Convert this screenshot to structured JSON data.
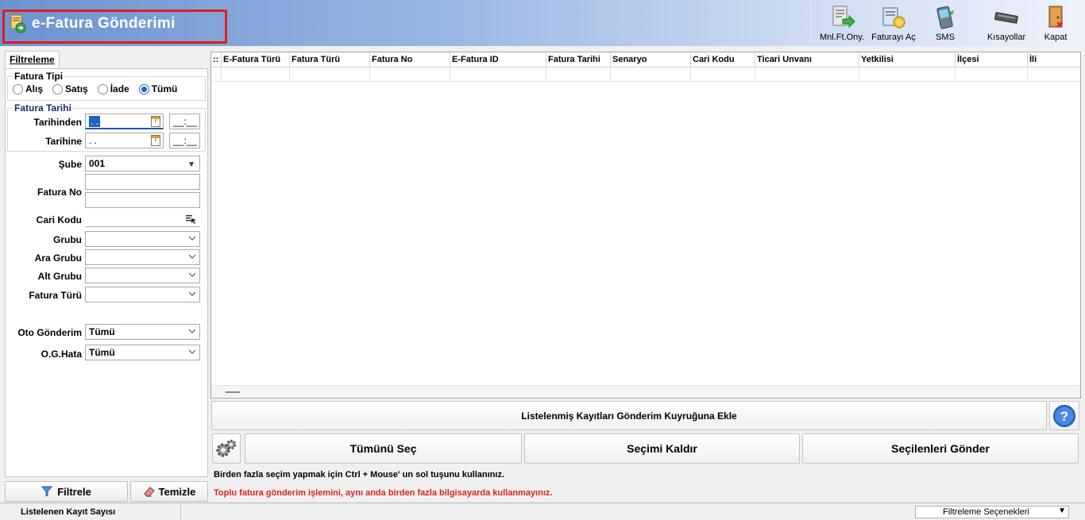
{
  "window": {
    "title": "e-Fatura Gönderimi"
  },
  "toolbar": {
    "items": [
      {
        "label": "Mnl.Ft.Ony.",
        "icon": "manual-invoice-approve-icon"
      },
      {
        "label": "Faturayı Aç",
        "icon": "open-invoice-icon"
      },
      {
        "label": "SMS",
        "icon": "sms-phone-icon"
      },
      {
        "label": "Kısayollar",
        "icon": "keyboard-shortcuts-icon"
      },
      {
        "label": "Kapat",
        "icon": "exit-door-icon"
      }
    ]
  },
  "filter": {
    "tab_label": "Filtreleme",
    "invoice_type": {
      "legend": "Fatura Tipi",
      "options": [
        "Alış",
        "Satış",
        "İade",
        "Tümü"
      ],
      "selected": "Tümü"
    },
    "invoice_date": {
      "legend": "Fatura Tarihi",
      "from_label": "Tarihinden",
      "from_value": ". .",
      "from_time": "__:__",
      "to_label": "Tarihine",
      "to_value": ". .",
      "to_time": "__:__"
    },
    "branch": {
      "label": "Şube",
      "value": "001"
    },
    "invoice_no": {
      "label": "Fatura No",
      "value": ""
    },
    "account_code": {
      "label": "Cari Kodu",
      "value": ""
    },
    "group": {
      "label": "Grubu",
      "value": ""
    },
    "sub_group": {
      "label": "Ara Grubu",
      "value": ""
    },
    "lower_group": {
      "label": "Alt Grubu",
      "value": ""
    },
    "invoice_kind": {
      "label": "Fatura Türü",
      "value": ""
    },
    "auto_send": {
      "label": "Oto Gönderim",
      "value": "Tümü"
    },
    "auto_send_error": {
      "label": "O.G.Hata",
      "value": "Tümü"
    },
    "filter_button": "Filtrele",
    "clear_button": "Temizle"
  },
  "grid": {
    "corner": "::",
    "columns": [
      "E-Fatura Türü",
      "Fatura Türü",
      "Fatura No",
      "E-Fatura ID",
      "Fatura Tarihi",
      "Senaryo",
      "Cari Kodu",
      "Ticari Unvanı",
      "Yetkilisi",
      "İlçesi",
      "İli"
    ]
  },
  "actions": {
    "add_to_queue": "Listelenmiş Kayıtları Gönderim Kuyruğuna Ekle",
    "select_all": "Tümünü Seç",
    "deselect": "Seçimi Kaldır",
    "send_selected": "Seçilenleri Gönder"
  },
  "info": {
    "hint": "Birden fazla seçim yapmak için Ctrl + Mouse' un sol tuşunu kullanınız.",
    "warning": "Toplu fatura gönderim işlemini, aynı anda birden fazla bilgisayarda kullanmayınız."
  },
  "status": {
    "record_count_label": "Listelenen Kayıt Sayısı",
    "filter_options": "Filtreleme Seçenekleri"
  },
  "colors": {
    "header_gradient_start": "#6b93cf",
    "highlight_border": "#e01c1c",
    "warning_text": "#e0201c",
    "selection": "#1f63c6"
  }
}
